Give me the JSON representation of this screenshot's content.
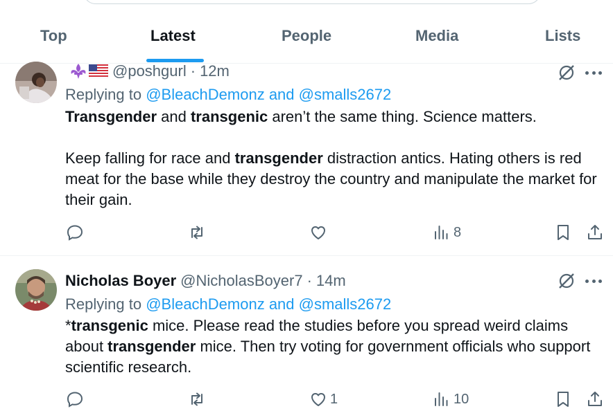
{
  "tabs": [
    "Top",
    "Latest",
    "People",
    "Media",
    "Lists"
  ],
  "active_tab": "Latest",
  "tweets": [
    {
      "display_name": "",
      "handle": "@poshgurl",
      "time": "12m",
      "flair": [
        "fleur-de-lis-emoji",
        "us-flag-emoji"
      ],
      "reply_prefix": "Replying to ",
      "reply_to": "@BleachDemonz and @smalls2672",
      "views": "8",
      "likes": "",
      "paragraphs": [
        [
          {
            "t": "Transgender",
            "b": true
          },
          {
            "t": " and "
          },
          {
            "t": "transgenic",
            "b": true
          },
          {
            "t": " aren’t the same thing. Science matters."
          }
        ],
        [
          {
            "t": "Keep falling for race and "
          },
          {
            "t": "transgender",
            "b": true
          },
          {
            "t": " distraction antics. Hating others is red meat for the base while they destroy the country and manipulate the market for their gain."
          }
        ]
      ]
    },
    {
      "display_name": "Nicholas Boyer",
      "handle": "@NicholasBoyer7",
      "time": "14m",
      "reply_prefix": "Replying to ",
      "reply_to": "@BleachDemonz and @smalls2672",
      "views": "10",
      "likes": "1",
      "paragraphs": [
        [
          {
            "t": "*"
          },
          {
            "t": "transgenic",
            "b": true
          },
          {
            "t": " mice. Please read the studies before you spread weird claims about "
          },
          {
            "t": "transgender",
            "b": true
          },
          {
            "t": " mice. Then try voting for government officials who support scientific research."
          }
        ]
      ]
    }
  ],
  "icons": {
    "reply": "reply-icon",
    "repost": "repost-icon",
    "like": "like-icon",
    "views": "views-icon",
    "bookmark": "bookmark-icon",
    "share": "share-icon",
    "grok": "grok-icon",
    "more": "more-icon"
  },
  "colors": {
    "accent": "#1d9bf0",
    "text": "#0f1419",
    "secondary": "#536471",
    "divider": "#eff3f4"
  }
}
